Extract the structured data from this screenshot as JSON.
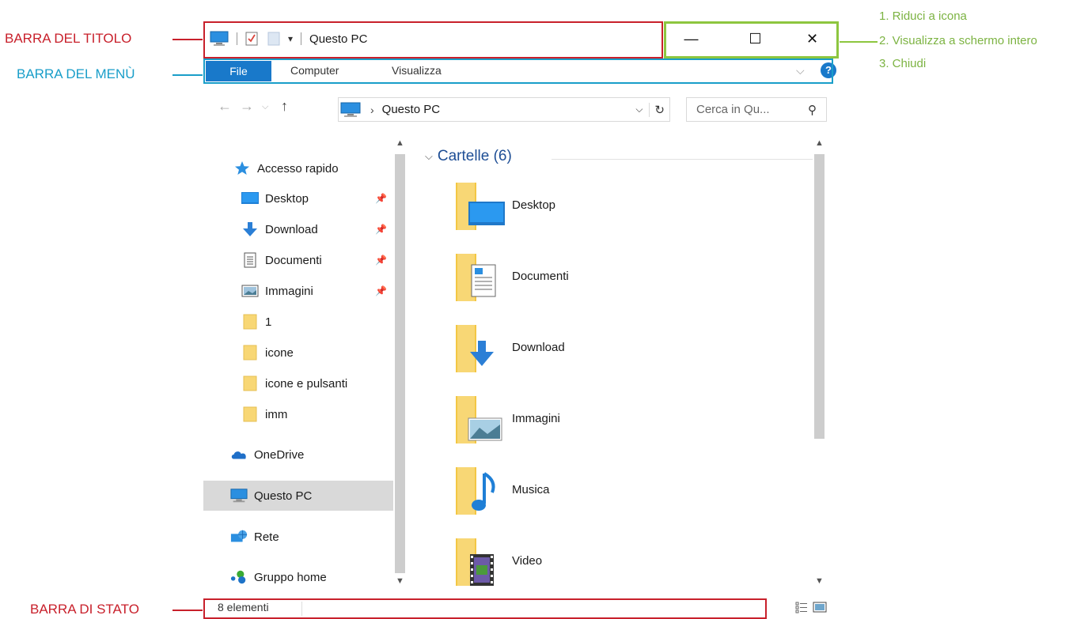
{
  "annotations": {
    "title_bar": "BARRA DEL TITOLO",
    "menu_bar": "BARRA DEL MENÙ",
    "status_bar": "BARRA DI STATO",
    "controls": [
      "1. Riduci a icona",
      "2. Visualizza a schermo intero",
      "3. Chiudi"
    ],
    "colors": {
      "red": "#c8202b",
      "blue": "#199ec9",
      "green": "#8dc63f"
    }
  },
  "window": {
    "title": "Questo PC",
    "controls": {
      "minimize": "—",
      "maximize": "☐",
      "close": "✕"
    }
  },
  "ribbon": {
    "tabs": [
      "File",
      "Computer",
      "Visualizza"
    ],
    "expand": "⌵",
    "help": "?"
  },
  "address": {
    "path_sep": "›",
    "path": "Questo PC",
    "search_placeholder": "Cerca in Qu..."
  },
  "nav": {
    "quick_access": "Accesso rapido",
    "items": [
      {
        "label": "Desktop",
        "icon": "desktop-icon",
        "pinned": true
      },
      {
        "label": "Download",
        "icon": "download-icon",
        "pinned": true
      },
      {
        "label": "Documenti",
        "icon": "documents-icon",
        "pinned": true
      },
      {
        "label": "Immagini",
        "icon": "pictures-icon",
        "pinned": true
      },
      {
        "label": "1",
        "icon": "folder-icon",
        "pinned": false
      },
      {
        "label": "icone",
        "icon": "folder-icon",
        "pinned": false
      },
      {
        "label": "icone e pulsanti",
        "icon": "folder-icon",
        "pinned": false
      },
      {
        "label": "imm",
        "icon": "folder-icon",
        "pinned": false
      }
    ],
    "onedrive": "OneDrive",
    "this_pc": "Questo PC",
    "network": "Rete",
    "homegroup": "Gruppo home"
  },
  "content": {
    "group": "Cartelle (6)",
    "folders": [
      "Desktop",
      "Documenti",
      "Download",
      "Immagini",
      "Musica",
      "Video"
    ]
  },
  "status": {
    "count": "8 elementi"
  }
}
